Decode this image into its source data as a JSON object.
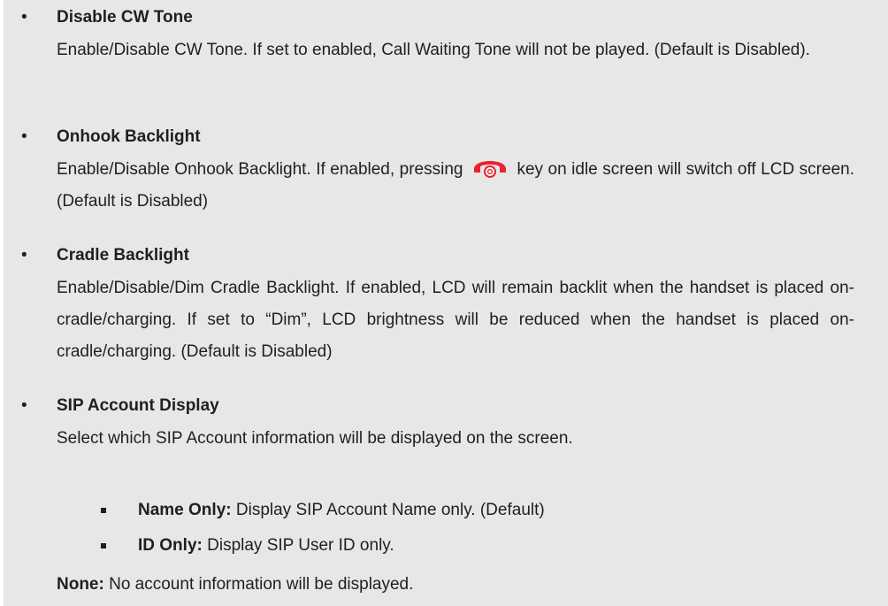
{
  "items": [
    {
      "title": "Disable CW Tone",
      "body": "Enable/Disable CW Tone. If set to enabled, Call Waiting Tone will not be played. (Default is Disabled)."
    },
    {
      "title": "Onhook Backlight",
      "body_before_icon": "Enable/Disable Onhook Backlight. If enabled, pressing",
      "icon": "hang-up-phone-icon",
      "body_after_icon": "key on idle screen will switch off LCD screen. (Default is Disabled)"
    },
    {
      "title": "Cradle Backlight",
      "body": "Enable/Disable/Dim Cradle Backlight. If enabled, LCD will remain backlit when the handset is placed on-cradle/charging. If set to “Dim”, LCD brightness will be reduced when the handset is placed on-cradle/charging. (Default is Disabled)"
    },
    {
      "title": "SIP Account Display",
      "body": "Select which SIP Account information will be displayed on the screen.",
      "options": [
        {
          "label": "Name Only:",
          "text": " Display SIP Account Name only. (Default)"
        },
        {
          "label": "ID Only:",
          "text": " Display SIP User ID only."
        }
      ],
      "none_label": "None:",
      "none_text": " No account information will be displayed."
    }
  ],
  "colors": {
    "background": "#e7e7e7",
    "text": "#1f1f1f",
    "icon": "#e8232d"
  }
}
